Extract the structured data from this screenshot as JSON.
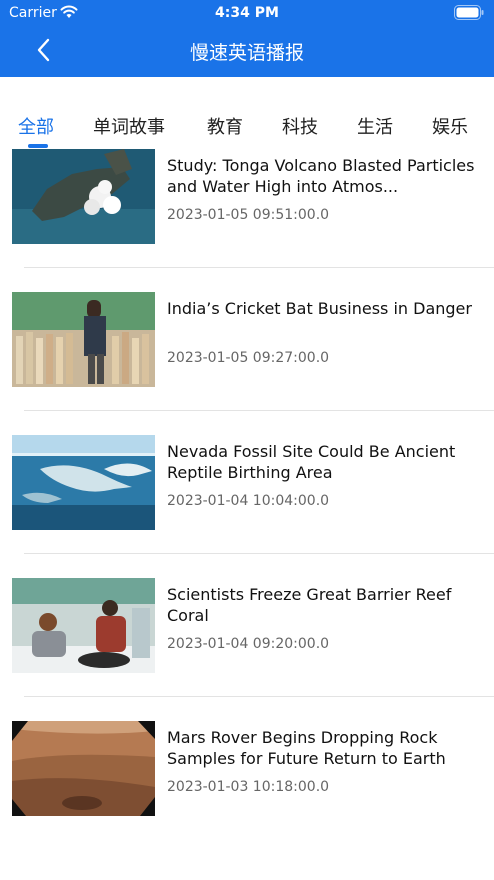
{
  "status_bar": {
    "carrier": "Carrier",
    "time": "4:34 PM"
  },
  "header": {
    "title": "慢速英语播报"
  },
  "tabs": [
    {
      "label": "全部",
      "active": true
    },
    {
      "label": "单词故事"
    },
    {
      "label": "教育"
    },
    {
      "label": "科技"
    },
    {
      "label": "生活"
    },
    {
      "label": "娱乐"
    }
  ],
  "articles": [
    {
      "title": "Study: Tonga Volcano Blasted Particles and Water High into Atmos...",
      "date": "2023-01-05 09:51:00.0",
      "image": "volcano-satellite-image"
    },
    {
      "title": "India’s Cricket Bat Business in Danger",
      "date": "2023-01-05 09:27:00.0",
      "image": "cricket-bat-workshop-image"
    },
    {
      "title": "Nevada Fossil Site Could Be Ancient Reptile Birthing Area",
      "date": "2023-01-04 10:04:00.0",
      "image": "ichthyosaur-illustration-image"
    },
    {
      "title": "Scientists Freeze Great Barrier Reef Coral",
      "date": "2023-01-04 09:20:00.0",
      "image": "lab-scientists-image"
    },
    {
      "title": "Mars Rover Begins Dropping Rock Samples for Future Return to Earth",
      "date": "2023-01-03 10:18:00.0",
      "image": "mars-surface-image"
    }
  ],
  "colors": {
    "primary": "#1a73e8",
    "text": "#111111",
    "date": "#666666"
  }
}
